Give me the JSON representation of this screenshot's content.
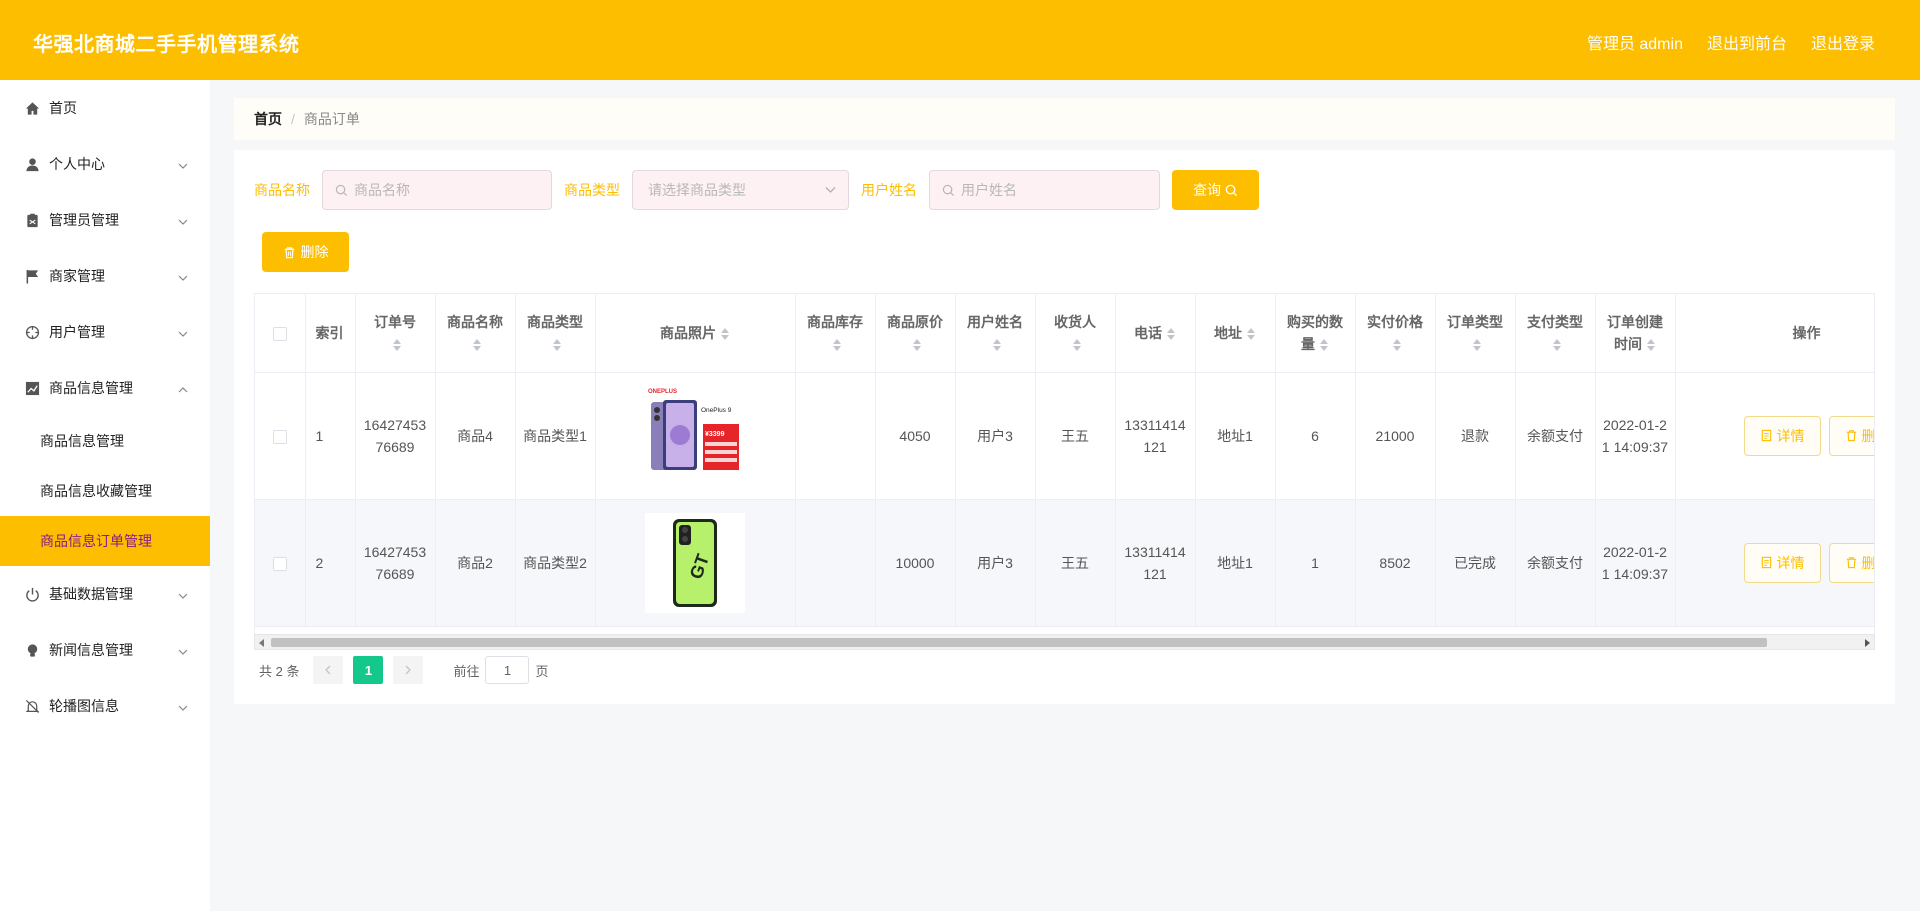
{
  "header": {
    "title": "华强北商城二手手机管理系统",
    "admin_label": "管理员 admin",
    "to_front": "退出到前台",
    "logout": "退出登录",
    "bg_color": "#fdbe00"
  },
  "sidebar": {
    "items": [
      {
        "label": "首页",
        "icon": "home-icon"
      },
      {
        "label": "个人中心",
        "icon": "user-icon"
      },
      {
        "label": "管理员管理",
        "icon": "clipboard-icon"
      },
      {
        "label": "商家管理",
        "icon": "flag-icon"
      },
      {
        "label": "用户管理",
        "icon": "crosshair-icon"
      },
      {
        "label": "商品信息管理",
        "icon": "chart-icon"
      },
      {
        "label": "基础数据管理",
        "icon": "power-icon"
      },
      {
        "label": "新闻信息管理",
        "icon": "bulb-icon"
      },
      {
        "label": "轮播图信息",
        "icon": "bell-off-icon"
      }
    ],
    "sub_items": [
      "商品信息管理",
      "商品信息收藏管理",
      "商品信息订单管理"
    ],
    "active_sub": "商品信息订单管理"
  },
  "breadcrumb": {
    "home": "首页",
    "separator": "/",
    "current": "商品订单"
  },
  "filters": {
    "name_label": "商品名称",
    "name_placeholder": "商品名称",
    "type_label": "商品类型",
    "type_placeholder": "请选择商品类型",
    "user_label": "用户姓名",
    "user_placeholder": "用户姓名",
    "query_button": "查询",
    "delete_button": "删除"
  },
  "table": {
    "columns": {
      "index": "索引",
      "order_no": "订单号",
      "goods_name": "商品名称",
      "goods_type": "商品类型",
      "goods_photo": "商品照片",
      "stock": "商品库存",
      "original_price": "商品原价",
      "user_name": "用户姓名",
      "receiver": "收货人",
      "phone": "电话",
      "address": "地址",
      "quantity": "购买的数量",
      "paid_price": "实付价格",
      "order_type": "订单类型",
      "pay_type": "支付类型",
      "created_at": "订单创建时间",
      "actions": "操作"
    },
    "rows": [
      {
        "index": "1",
        "order_no": "1642745376689",
        "goods_name": "商品4",
        "goods_type": "商品类型1",
        "stock": "",
        "original_price": "4050",
        "user_name": "用户3",
        "receiver": "王五",
        "phone": "13311414121",
        "address": "地址1",
        "quantity": "6",
        "paid_price": "21000",
        "order_type": "退款",
        "pay_type": "余额支付",
        "created_at": "2022-01-21 14:09:37",
        "detail_label": "详情",
        "delete_label": "删",
        "photo_brand": "ONEPLUS",
        "photo_model": "OnePlus 9",
        "photo_price": "¥3399"
      },
      {
        "index": "2",
        "order_no": "1642745376689",
        "goods_name": "商品2",
        "goods_type": "商品类型2",
        "stock": "",
        "original_price": "10000",
        "user_name": "用户3",
        "receiver": "王五",
        "phone": "13311414121",
        "address": "地址1",
        "quantity": "1",
        "paid_price": "8502",
        "order_type": "已完成",
        "pay_type": "余额支付",
        "created_at": "2022-01-21 14:09:37",
        "detail_label": "详情",
        "delete_label": "删",
        "photo_brand": "GT",
        "photo_model": "",
        "photo_price": ""
      }
    ]
  },
  "pagination": {
    "total": "共 2 条",
    "current_page": "1",
    "goto_label": "前往",
    "goto_value": "1",
    "page_suffix": "页"
  }
}
